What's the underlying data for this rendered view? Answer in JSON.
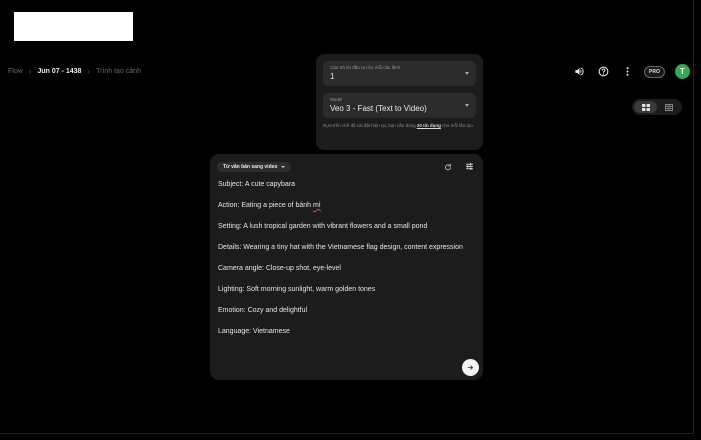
{
  "breadcrumb": {
    "root": "Flow",
    "project": "Jun 07 - 1438",
    "section": "Trình tạo cảnh"
  },
  "settings": {
    "outputs_label": "Câu trả lời đầu ra cho mỗi câu lệnh",
    "outputs_value": "1",
    "model_label": "Model",
    "model_value": "Veo 3 - Fast (Text to Video)",
    "credits_prefix": "Dựa trên chế độ cài đặt hiện tại, bạn cần dùng",
    "credits_amount": "20 tín dụng",
    "credits_suffix": "cho mỗi lần tạo."
  },
  "header": {
    "plan_badge": "PRO",
    "avatar_initial": "T"
  },
  "prompt": {
    "mode_label": "Từ văn bản sang video",
    "lines": [
      "Subject: A cute capybara",
      "Action: Eating a piece of bánh ",
      "Setting: A lush tropical garden with vibrant flowers and a small pond",
      "Details: Wearing a tiny hat with the Vietnamese flag design, content expression",
      "Camera angle: Close-up shot, eye-level",
      "Lighting: Soft morning sunlight, warm golden tones",
      "Emotion: Cozy and delightful",
      "Language: Vietnamese"
    ],
    "misspelled_word": "mì"
  },
  "colors": {
    "background": "#000000",
    "panel": "#1c1c1c",
    "avatar": "#34a853"
  },
  "icons": {
    "volume": "speaker-icon",
    "help": "help-circle-icon",
    "menu": "more-vert-icon",
    "grid": "grid-view-icon",
    "list": "list-view-icon",
    "reset": "refresh-icon",
    "tune": "tune-icon",
    "send": "arrow-right-icon"
  }
}
